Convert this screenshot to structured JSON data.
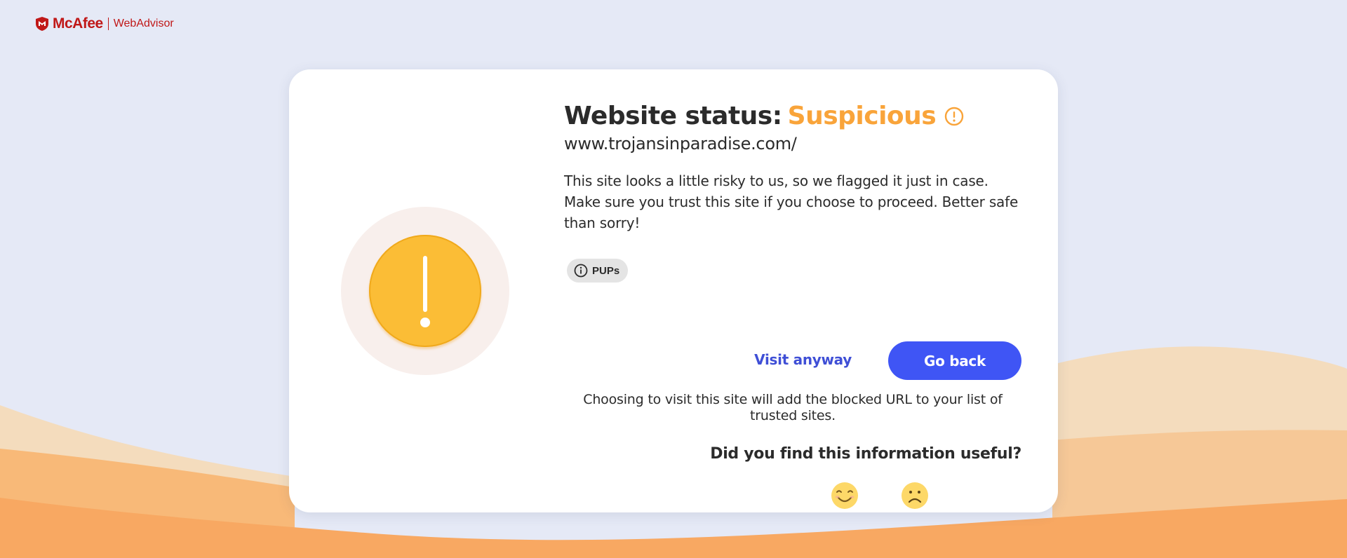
{
  "brand": {
    "name": "McAfee",
    "product": "WebAdvisor",
    "color": "#c01818"
  },
  "status": {
    "label": "Website status:",
    "value": "Suspicious",
    "color": "#f9a43a"
  },
  "site": {
    "url": "www.trojansinparadise.com/"
  },
  "description": "This site looks a little risky to us, so we flagged it just in case. Make sure you trust this site if you choose to proceed. Better safe than sorry!",
  "category_chip": {
    "label": "PUPs",
    "icon": "info-icon"
  },
  "actions": {
    "visit_anyway_label": "Visit anyway",
    "go_back_label": "Go back",
    "accent_color": "#3f55f5"
  },
  "note": "Choosing to visit this site will add the blocked URL to your list of trusted sites.",
  "feedback": {
    "question": "Did you find this information useful?",
    "options": [
      {
        "name": "happy",
        "icon": "happy-face-icon"
      },
      {
        "name": "sad",
        "icon": "sad-face-icon"
      }
    ]
  },
  "hero": {
    "icon": "warning-exclamation-icon",
    "color": "#fbbd36"
  }
}
